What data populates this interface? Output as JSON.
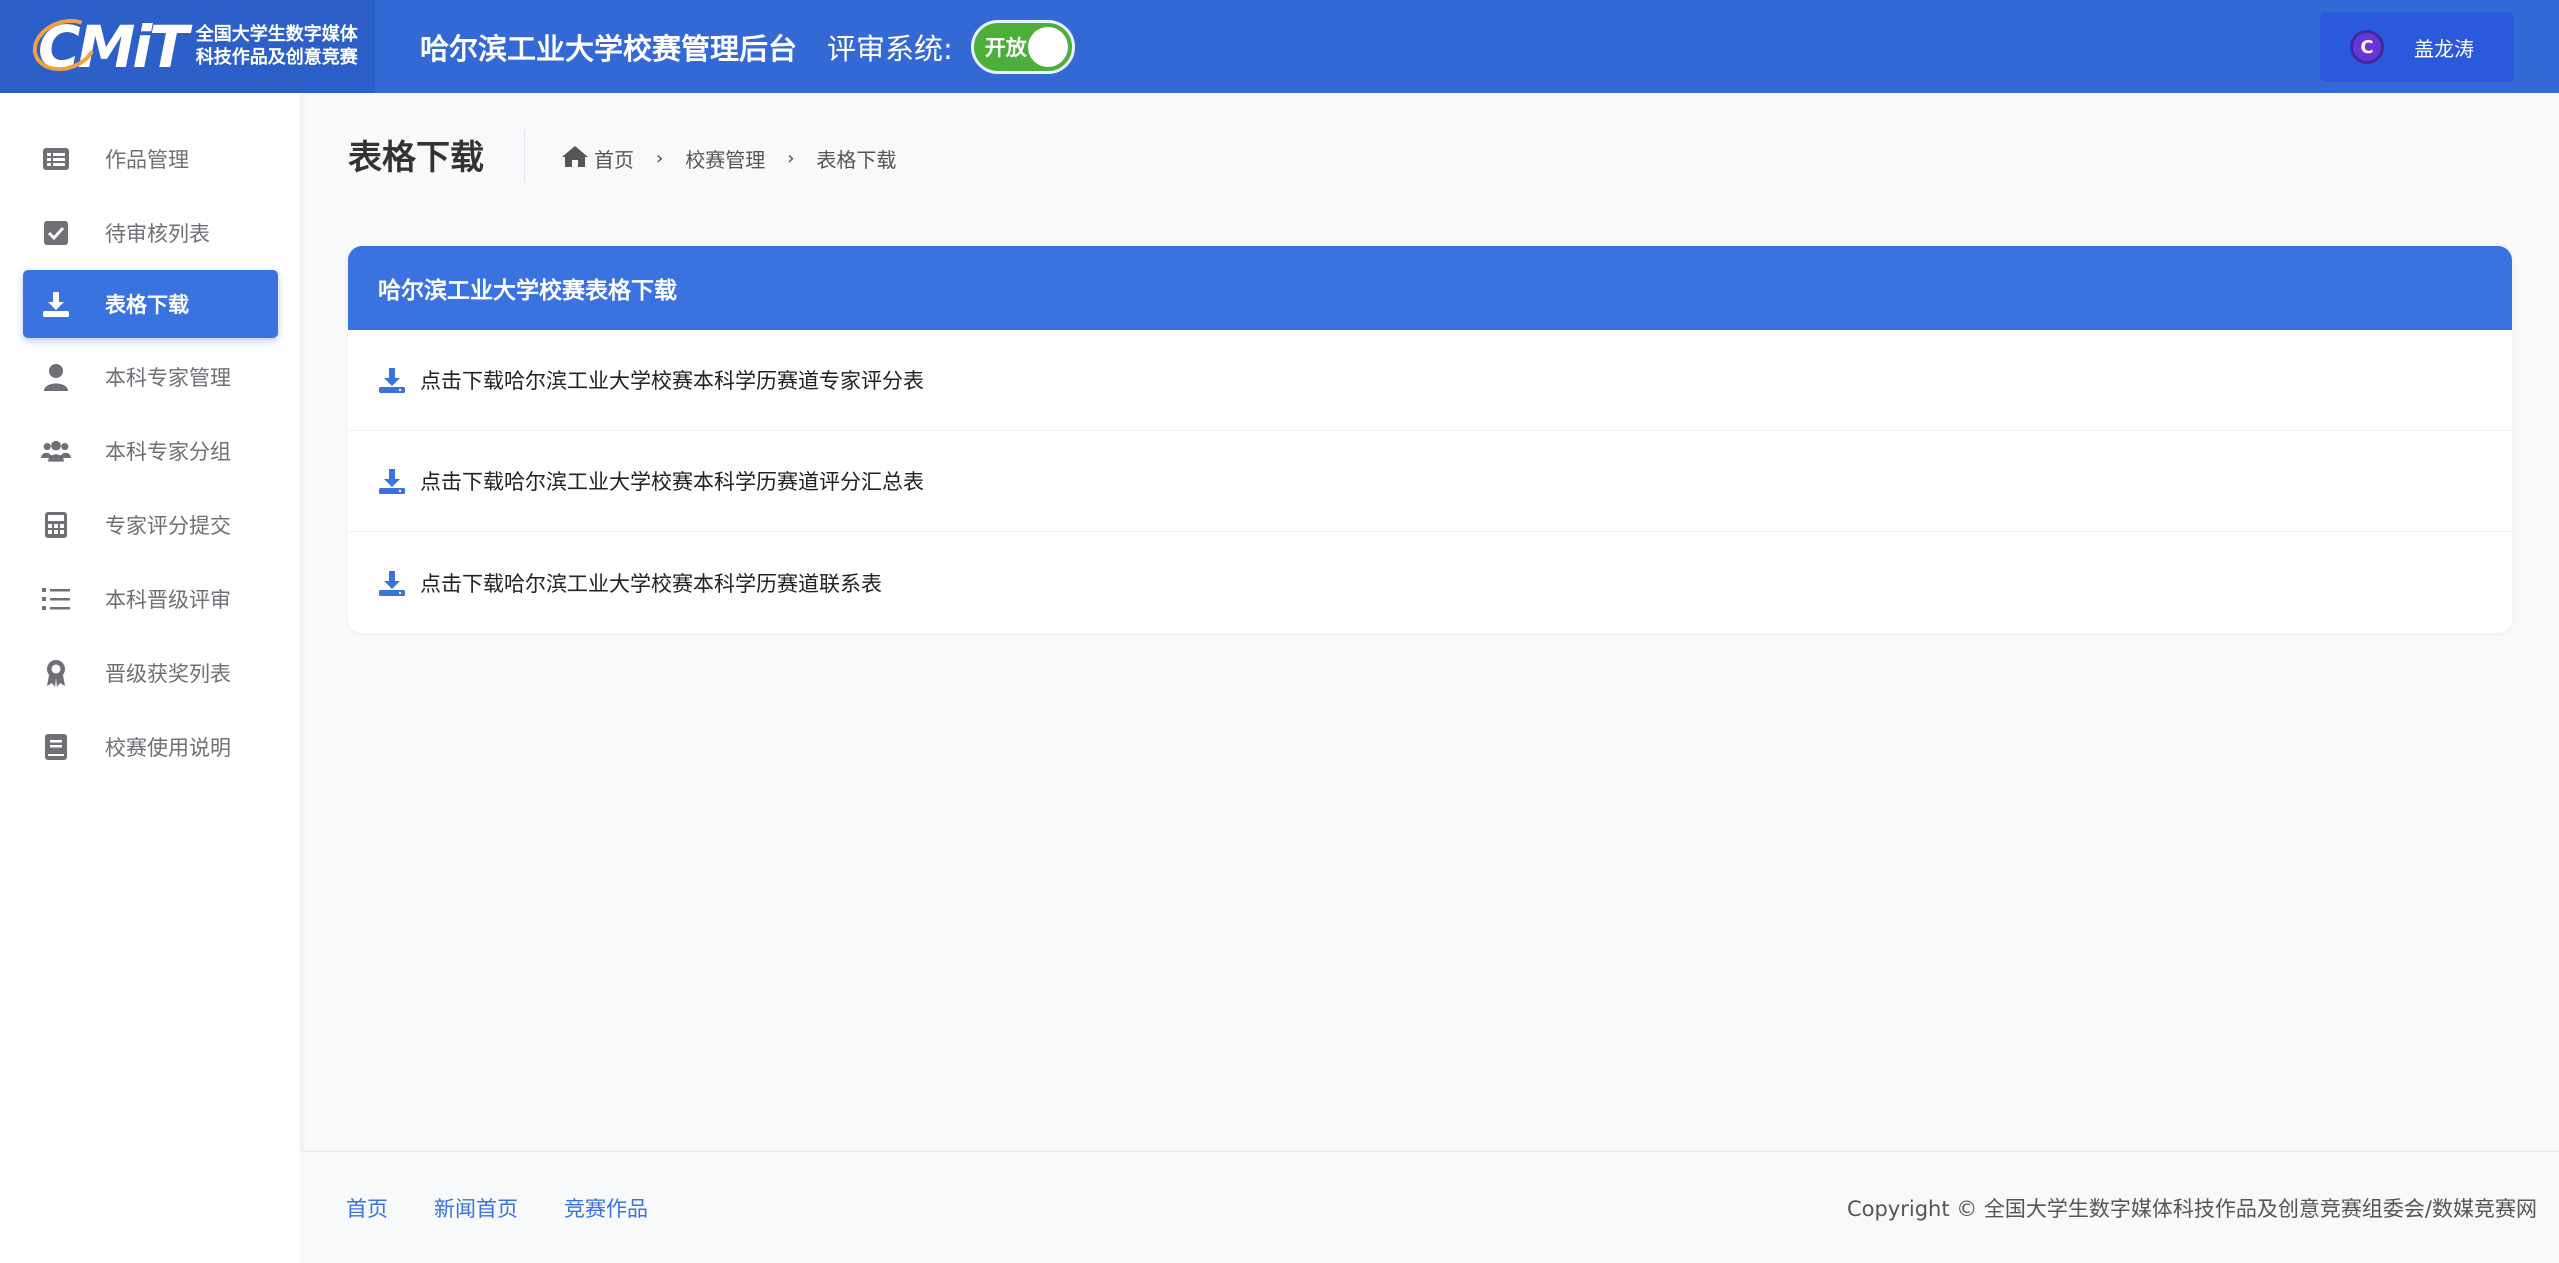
{
  "header": {
    "logo_letters": "CMiT",
    "logo_line1": "全国大学生数字媒体",
    "logo_line2": "科技作品及创意竞赛",
    "site_title": "哈尔滨工业大学校赛管理后台",
    "review_label": "评审系统:",
    "toggle_label": "开放",
    "toggle_on": true,
    "user": {
      "avatar_letter": "C",
      "name": "盖龙涛"
    }
  },
  "sidebar": {
    "items": [
      {
        "label": "作品管理",
        "icon": "list-icon",
        "active": false
      },
      {
        "label": "待审核列表",
        "icon": "check-square-icon",
        "active": false
      },
      {
        "label": "表格下载",
        "icon": "download-icon",
        "active": true
      },
      {
        "label": "本科专家管理",
        "icon": "user-icon",
        "active": false
      },
      {
        "label": "本科专家分组",
        "icon": "users-icon",
        "active": false
      },
      {
        "label": "专家评分提交",
        "icon": "calculator-icon",
        "active": false
      },
      {
        "label": "本科晋级评审",
        "icon": "ordered-list-icon",
        "active": false
      },
      {
        "label": "晋级获奖列表",
        "icon": "award-icon",
        "active": false
      },
      {
        "label": "校赛使用说明",
        "icon": "book-icon",
        "active": false
      }
    ]
  },
  "main": {
    "page_title": "表格下载",
    "breadcrumb": [
      "首页",
      "校赛管理",
      "表格下载"
    ],
    "panel": {
      "title": "哈尔滨工业大学校赛表格下载",
      "rows": [
        "点击下载哈尔滨工业大学校赛本科学历赛道专家评分表",
        "点击下载哈尔滨工业大学校赛本科学历赛道评分汇总表",
        "点击下载哈尔滨工业大学校赛本科学历赛道联系表"
      ]
    }
  },
  "footer": {
    "links": [
      "首页",
      "新闻首页",
      "竞赛作品"
    ],
    "copyright": "Copyright © 全国大学生数字媒体科技作品及创意竞赛组委会/数媒竞赛网"
  },
  "colors": {
    "header_bg": "#3468d4",
    "accent": "#3a72e0",
    "toggle_on": "#4caf3a"
  }
}
